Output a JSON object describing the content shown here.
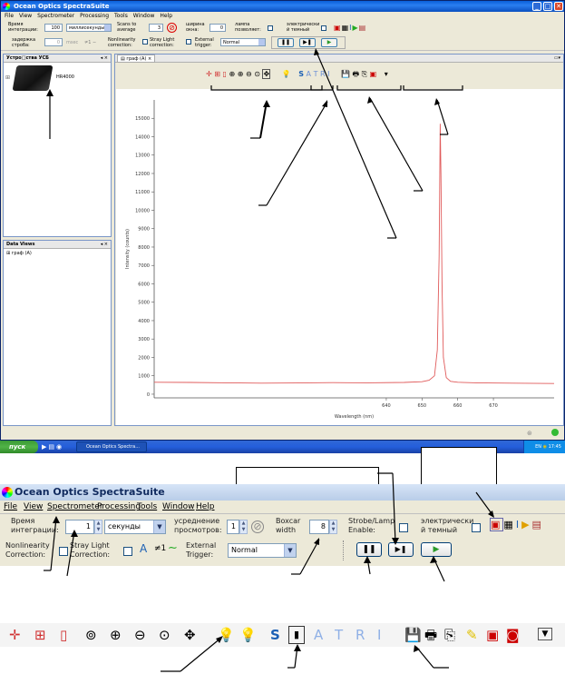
{
  "app": {
    "title": "Ocean Optics SpectraSuite",
    "window_buttons": [
      "_",
      "□",
      "✕"
    ]
  },
  "menu": [
    "File",
    "View",
    "Spectrometer",
    "Processing",
    "Tools",
    "Window",
    "Help"
  ],
  "toolbar_small": {
    "integration_label": "Время интеграции:",
    "integration_value": "100",
    "integration_unit": "миллисекунды",
    "scans_label": "Scans to average",
    "scans_value": "3",
    "boxcar_label": "ширина окна:",
    "boxcar_value": "0",
    "lamp_label": "лампа позволяет:",
    "dark_label": "электрически й темный",
    "delay_label": "задержка строба:",
    "delay_value": "0",
    "delay_unit": "msec",
    "nonlinearity_label": "Nonlinearity correction:",
    "stray_label": "Stray Light correction:",
    "trigger_label": "External trigger:",
    "trigger_value": "Normal"
  },
  "left_panel": {
    "devices_title": "Устро□ства УСБ",
    "device_name": "HR4000",
    "dataviews_title": "Data Views",
    "dataviews_item": "граф (A)"
  },
  "graph_tab": "граф (A)",
  "chart_data": {
    "type": "line",
    "xlabel": "Wavelength (nm)",
    "ylabel": "Intensity (counts)",
    "xlim": [
      575,
      687
    ],
    "ylim": [
      -200,
      16000
    ],
    "x_ticks": [
      640,
      650,
      660,
      670
    ],
    "y_ticks": [
      0,
      1000,
      2000,
      3000,
      4000,
      5000,
      6000,
      7000,
      8000,
      9000,
      10000,
      11000,
      12000,
      13000,
      14000,
      15000
    ],
    "grid": false,
    "series": [
      {
        "color": "#e05a5a",
        "x": [
          575,
          585,
          595,
          605,
          615,
          625,
          635,
          645,
          650,
          652,
          653.5,
          654.3,
          654.8,
          655.1,
          655.3,
          655.6,
          656.0,
          656.8,
          658,
          660,
          665,
          675,
          687
        ],
        "values": [
          650,
          640,
          620,
          600,
          610,
          630,
          620,
          640,
          680,
          760,
          1000,
          2400,
          7500,
          14700,
          12000,
          6000,
          2000,
          900,
          700,
          650,
          620,
          600,
          580
        ]
      }
    ]
  },
  "zoom_titlebar": "Ocean Optics SpectraSuite",
  "zoom_menu": [
    "File",
    "View",
    "Spectrometer",
    "Processing",
    "Tools",
    "Window",
    "Help"
  ],
  "zoom_toolbar": {
    "integration_label": "Время интеграции:",
    "integration_value": "1",
    "integration_unit": "секунды",
    "averaging_label": "усреднение просмотров:",
    "averaging_value": "1",
    "boxcar_label": "Boxcar width",
    "boxcar_value": "8",
    "strobe_label": "Strobe/Lamp Enable:",
    "dark_label": "электрически й темный",
    "nonlinearity_label": "Nonlinearity Correction:",
    "stray_label": "Stray Light Correction:",
    "trigger_label": "External Trigger:",
    "trigger_value": "Normal"
  },
  "zoom_icons_text": {
    "s": "S",
    "a": "A",
    "t": "T",
    "r": "R",
    "i": "I"
  },
  "taskbar": {
    "start": "пуск",
    "app": "Ocean Optics Spectra...",
    "lang": "EN",
    "time": "17:45"
  }
}
